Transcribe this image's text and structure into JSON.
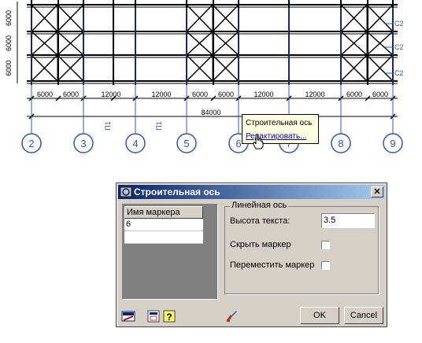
{
  "drawing": {
    "row_labels": [
      "6000",
      "6000",
      "6000"
    ],
    "side_labels": [
      "C2",
      "C2",
      "C2"
    ],
    "bay_dimensions": [
      "6000",
      "6000",
      "12000",
      "12000",
      "6000",
      "6000",
      "12000",
      "12000",
      "6000",
      "6000"
    ],
    "total_dimension": "84000",
    "axis_markers": [
      "2",
      "3",
      "4",
      "5",
      "6",
      "7",
      "8",
      "9"
    ],
    "element_marks": [
      "П1",
      "П1"
    ]
  },
  "tooltip": {
    "title": "Строительная ось",
    "link": "Редактировать..."
  },
  "dialog": {
    "title": "Строительная ось",
    "close": "✕",
    "list_header": "Имя маркера",
    "list_value": "6",
    "group_label": "Линейная ось",
    "text_height_label": "Высота текста:",
    "text_height_value": "3.5",
    "hide_marker_label": "Скрыть маркер",
    "move_marker_label": "Переместить маркер",
    "ok": "OK",
    "cancel": "Cancel"
  },
  "colors": {
    "axis_blue": "#3355bb",
    "title_bar": "#0a246a",
    "tooltip_bg": "#ffffe1"
  }
}
